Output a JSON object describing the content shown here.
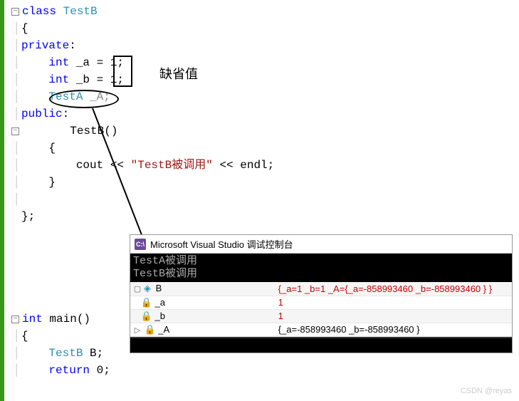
{
  "code": {
    "l1_kw": "class",
    "l1_type": " TestB",
    "l2": "{",
    "l3_kw": "private",
    "l3_c": ":",
    "l4_pre": "    ",
    "l4_kw": "int",
    "l4_v": " _a = 1;",
    "l5_pre": "    ",
    "l5_kw": "int",
    "l5_v": " _b = 1;",
    "l6_pre": "    ",
    "l6_type": "TestA",
    "l6_v": " _A;",
    "l7_kw": "public",
    "l7_c": ":",
    "l8_pre": "    ",
    "l8_ctor": "TestB()",
    "l9_pre": "    ",
    "l9": "{",
    "l10_pre": "        ",
    "l10_cout": "cout << ",
    "l10_str": "\"TestB被调用\"",
    "l10_endl": " << endl;",
    "l11_pre": "    ",
    "l11": "}",
    "l12": "",
    "l13": "};",
    "l14": "",
    "l15_kw": "int",
    "l15_fn": " main()",
    "l16": "{",
    "l17_pre": "    ",
    "l17_type": "TestB",
    "l17_v": " B;",
    "l18_pre": "    ",
    "l18_kw": "return",
    "l18_v": " 0;"
  },
  "annotation": {
    "default_val": "缺省值"
  },
  "console": {
    "icon": "C:\\",
    "title": "Microsoft Visual Studio 调试控制台",
    "out1": "TestA被调用",
    "out2": "TestB被调用"
  },
  "debug": {
    "rows": [
      {
        "exp": "▢",
        "icon": "◈",
        "name": "B",
        "value": "{_a=1 _b=1 _A={_a=-858993460 _b=-858993460 } }",
        "red": true
      },
      {
        "exp": "",
        "icon": "🔒",
        "name": "_a",
        "value": "1",
        "red": true,
        "indent": 1
      },
      {
        "exp": "",
        "icon": "🔒",
        "name": "_b",
        "value": "1",
        "red": true,
        "indent": 1
      },
      {
        "exp": "▷",
        "icon": "🔒",
        "name": "_A",
        "value": "{_a=-858993460 _b=-858993460 }",
        "red": false,
        "indent": 1
      }
    ]
  },
  "watermark": "CSDN @reyas"
}
